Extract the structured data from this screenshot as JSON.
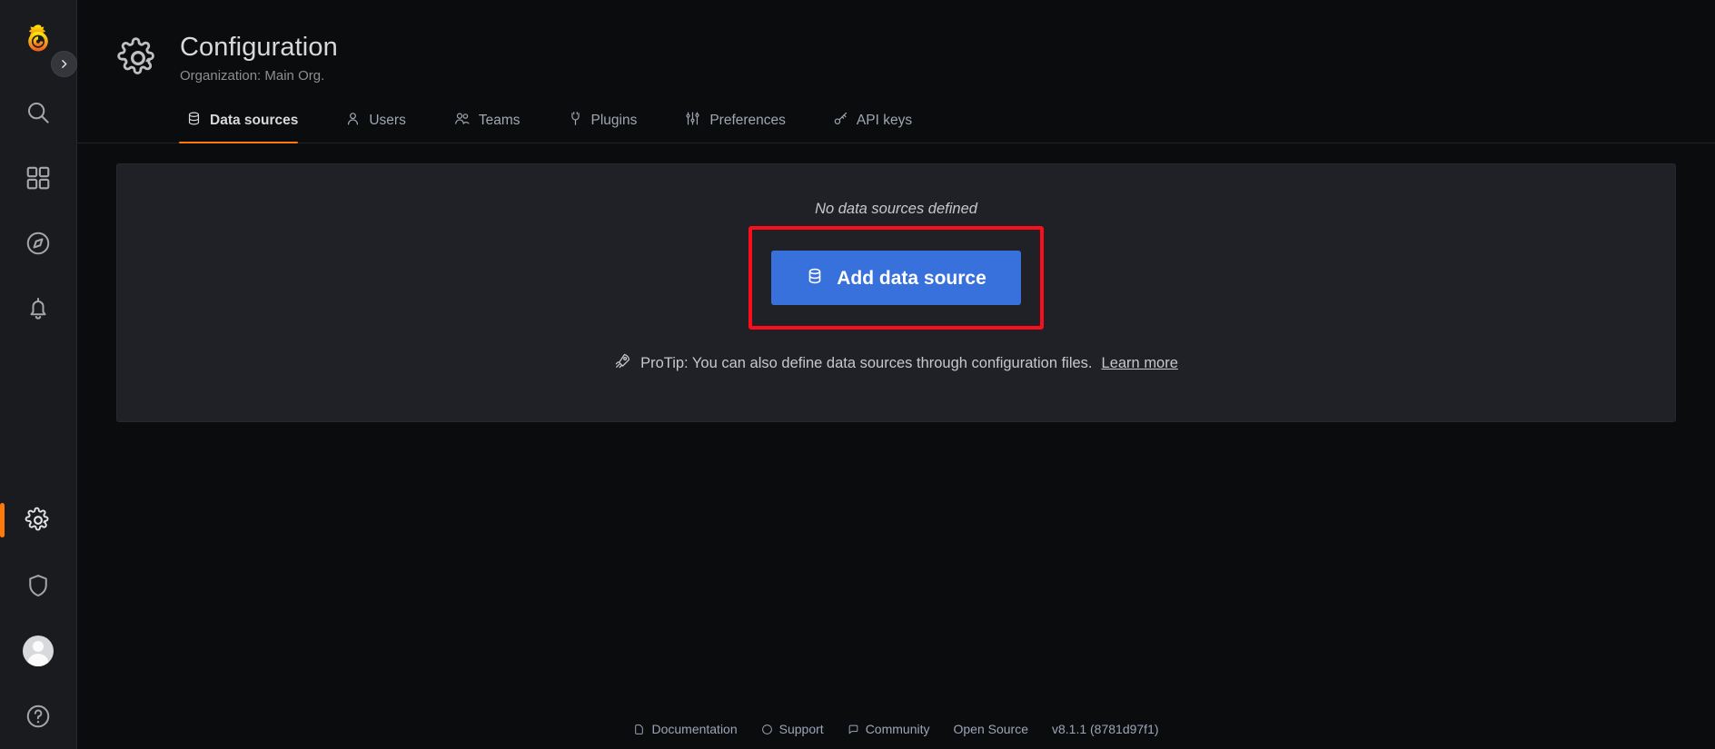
{
  "sidebar": {
    "logo": "grafana-logo",
    "expand_label": "›",
    "items": [
      {
        "name": "search",
        "icon": "search-icon",
        "active": false
      },
      {
        "name": "dashboards",
        "icon": "apps-grid-icon",
        "active": false
      },
      {
        "name": "explore",
        "icon": "compass-icon",
        "active": false
      },
      {
        "name": "alerting",
        "icon": "bell-icon",
        "active": false
      }
    ],
    "bottom_items": [
      {
        "name": "configuration",
        "icon": "gear-icon",
        "active": true
      },
      {
        "name": "server-admin",
        "icon": "shield-icon",
        "active": false
      },
      {
        "name": "profile",
        "icon": "avatar-icon",
        "active": false
      },
      {
        "name": "help",
        "icon": "help-icon",
        "active": false
      }
    ]
  },
  "header": {
    "icon": "gear-icon",
    "title": "Configuration",
    "subtitle": "Organization: Main Org."
  },
  "tabs": [
    {
      "label": "Data sources",
      "icon": "database-icon",
      "active": true
    },
    {
      "label": "Users",
      "icon": "user-icon",
      "active": false
    },
    {
      "label": "Teams",
      "icon": "users-icon",
      "active": false
    },
    {
      "label": "Plugins",
      "icon": "plug-icon",
      "active": false
    },
    {
      "label": "Preferences",
      "icon": "sliders-icon",
      "active": false
    },
    {
      "label": "API keys",
      "icon": "key-icon",
      "active": false
    }
  ],
  "main": {
    "empty_message": "No data sources defined",
    "add_button_label": "Add data source",
    "add_button_icon": "database-icon",
    "protip_icon": "rocket-icon",
    "protip_text": "ProTip: You can also define data sources through configuration files.",
    "protip_link": "Learn more"
  },
  "footer": {
    "items": [
      {
        "label": "Documentation",
        "icon": "document-icon"
      },
      {
        "label": "Support",
        "icon": "question-icon"
      },
      {
        "label": "Community",
        "icon": "comments-icon"
      },
      {
        "label": "Open Source",
        "icon": ""
      },
      {
        "label": "v8.1.1 (8781d97f1)",
        "icon": ""
      }
    ]
  },
  "colors": {
    "accent": "#ff780a",
    "primary_button": "#3871dc",
    "highlight": "#fc0d1b",
    "sidebar_bg": "#1a1b1f",
    "panel_bg": "#1f2126",
    "page_bg": "#0b0c0e"
  }
}
